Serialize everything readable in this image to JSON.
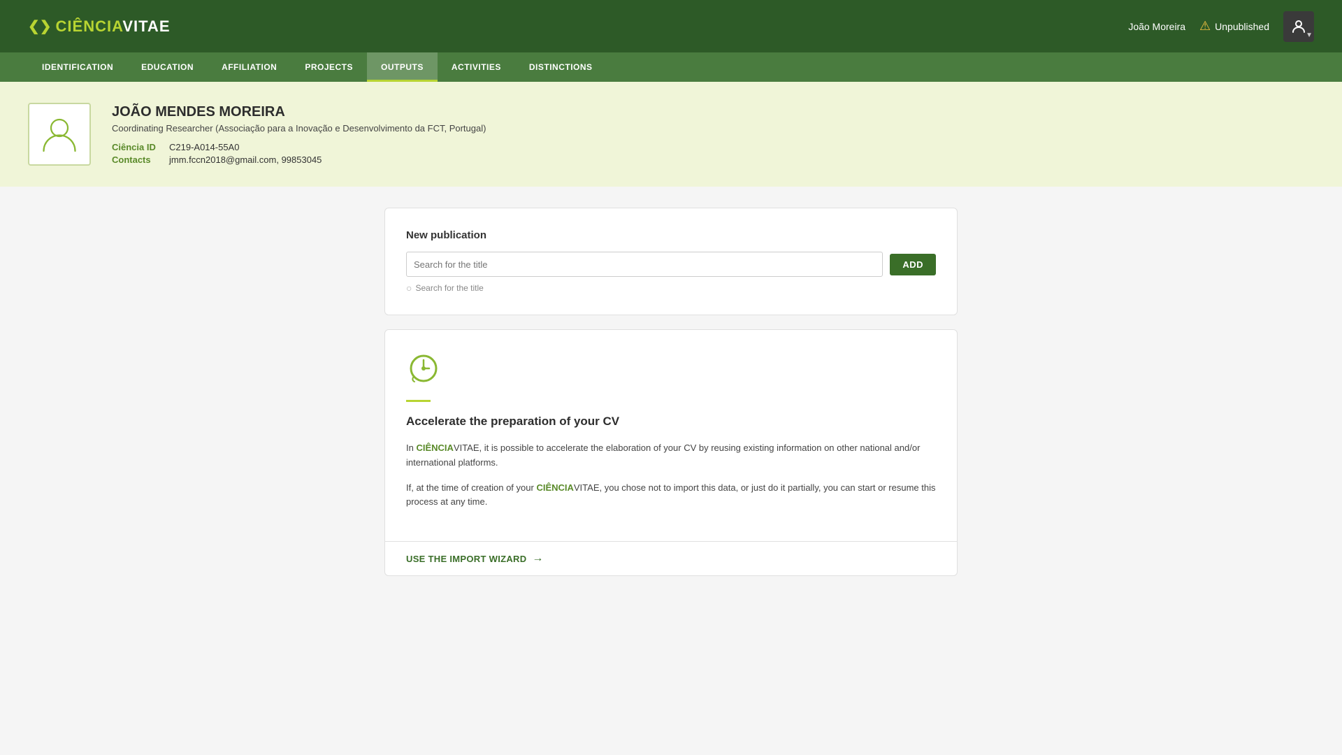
{
  "header": {
    "logo_ciencia": "CIÊNCIA",
    "logo_vitae": "VITAE",
    "logo_arrows": "❮❯",
    "user_name": "João Moreira",
    "unpublished_label": "Unpublished"
  },
  "nav": {
    "items": [
      {
        "id": "identification",
        "label": "IDENTIFICATION",
        "active": false
      },
      {
        "id": "education",
        "label": "EDUCATION",
        "active": false
      },
      {
        "id": "affiliation",
        "label": "AFFILIATION",
        "active": false
      },
      {
        "id": "projects",
        "label": "PROJECTS",
        "active": false
      },
      {
        "id": "outputs",
        "label": "OUTPUTS",
        "active": true
      },
      {
        "id": "activities",
        "label": "ACTIVITIES",
        "active": false
      },
      {
        "id": "distinctions",
        "label": "DISTINCTIONS",
        "active": false
      }
    ]
  },
  "profile": {
    "name": "JOÃO MENDES MOREIRA",
    "title": "Coordinating Researcher (Associação para a Inovação e Desenvolvimento da FCT, Portugal)",
    "ciencia_id_label": "Ciência ID",
    "ciencia_id_value": "C219-A014-55A0",
    "contacts_label": "Contacts",
    "contacts_value": "jmm.fccn2018@gmail.com, 99853045"
  },
  "new_publication": {
    "title": "New publication",
    "input_placeholder": "Search for the title",
    "add_button_label": "ADD",
    "search_hint": "Search for the title"
  },
  "import_section": {
    "title": "Accelerate the preparation of your CV",
    "paragraph1_prefix": "In ",
    "brand_ciencia": "CIÊNCIA",
    "brand_vitae": "VITAE",
    "paragraph1_suffix": ", it is possible to accelerate the elaboration of your CV by reusing existing information on other national and/or international platforms.",
    "paragraph2_prefix": "If, at the time of creation of your ",
    "paragraph2_brand_ciencia": "CIÊNCIA",
    "paragraph2_brand_vitae": "VITAE",
    "paragraph2_suffix": ", you chose not to import this data, or just do it partially, you can start or resume this process at any time.",
    "import_link_label": "USE THE IMPORT WIZARD"
  }
}
